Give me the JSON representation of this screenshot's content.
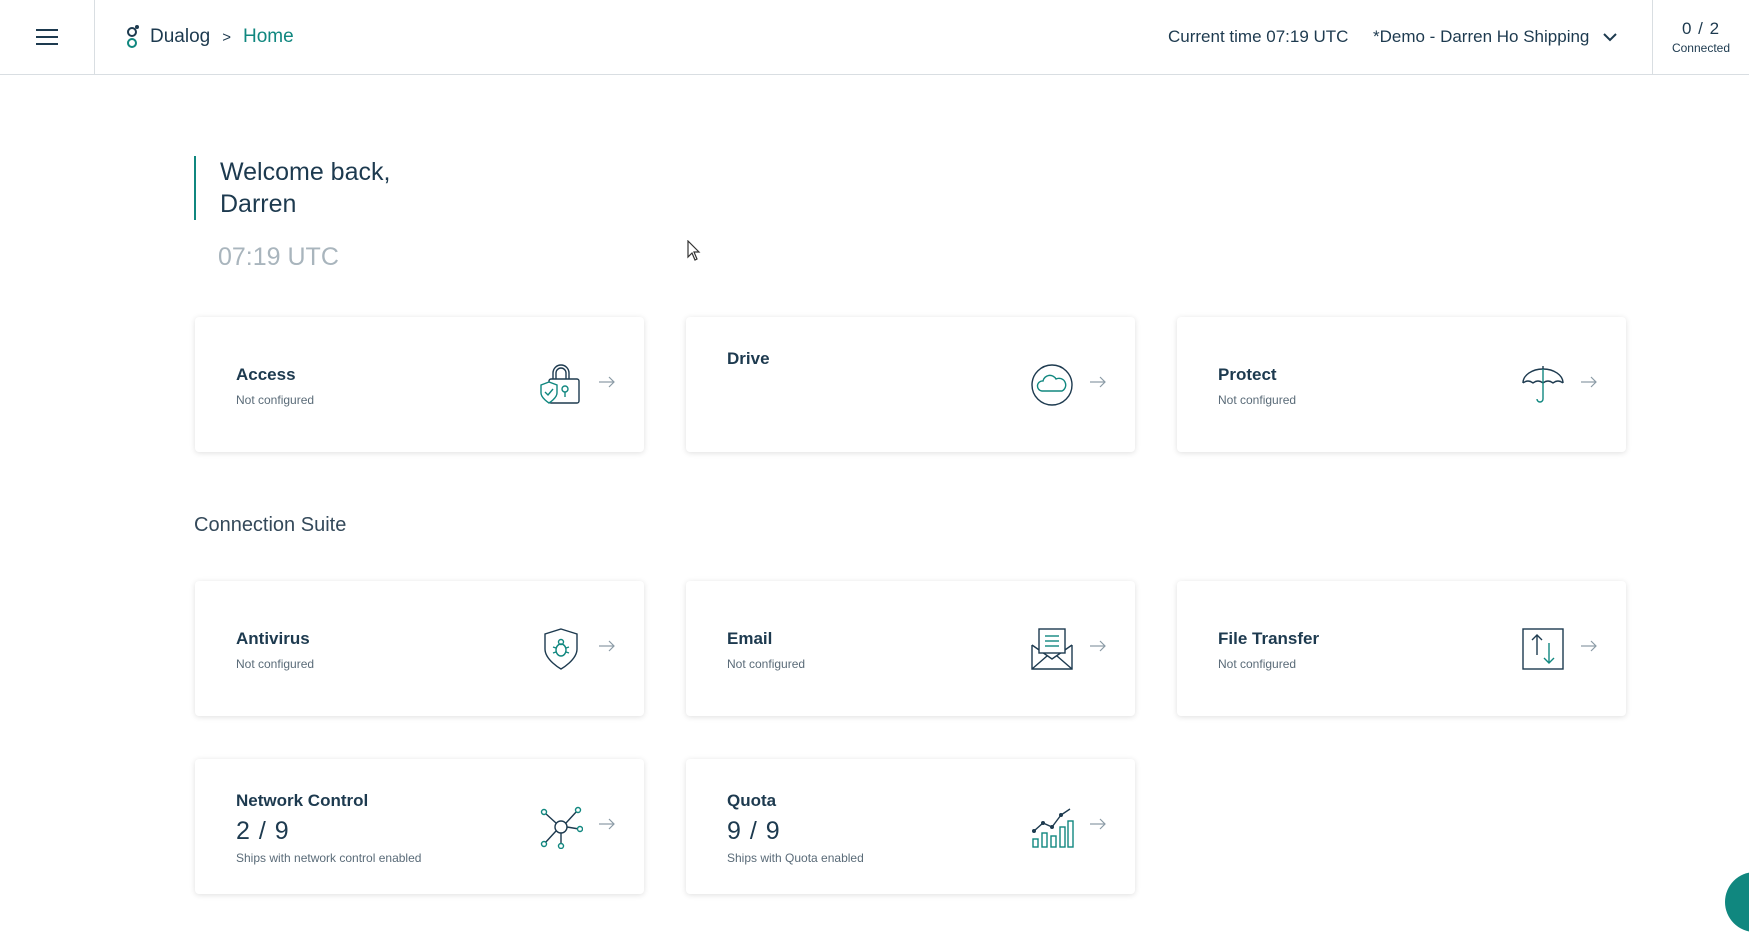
{
  "header": {
    "app_name": "Dualog",
    "breadcrumb_sep": ">",
    "breadcrumb_current": "Home",
    "current_time": "Current time 07:19 UTC",
    "company": "*Demo - Darren Ho Shipping",
    "connected_count": "0 / 2",
    "connected_label": "Connected"
  },
  "welcome": {
    "line1": "Welcome back,",
    "line2": "Darren",
    "time": "07:19 UTC"
  },
  "cards_top": [
    {
      "title": "Access",
      "sub": "Not configured",
      "icon": "lock-shield-icon"
    },
    {
      "title": "Drive",
      "sub": "",
      "icon": "cloud-icon"
    },
    {
      "title": "Protect",
      "sub": "Not configured",
      "icon": "umbrella-icon"
    }
  ],
  "section_title": "Connection Suite",
  "cards_suite": [
    {
      "title": "Antivirus",
      "sub": "Not configured",
      "icon": "bug-shield-icon"
    },
    {
      "title": "Email",
      "sub": "Not configured",
      "icon": "envelope-icon"
    },
    {
      "title": "File Transfer",
      "sub": "Not configured",
      "icon": "transfer-icon"
    },
    {
      "title": "Network Control",
      "value": "2 / 9",
      "sub": "Ships with network control enabled",
      "icon": "network-icon"
    },
    {
      "title": "Quota",
      "value": "9 / 9",
      "sub": "Ships with Quota enabled",
      "icon": "chart-icon"
    }
  ],
  "colors": {
    "accent": "#10877f",
    "text": "#1d3a4f",
    "muted": "#a9b5bd"
  }
}
